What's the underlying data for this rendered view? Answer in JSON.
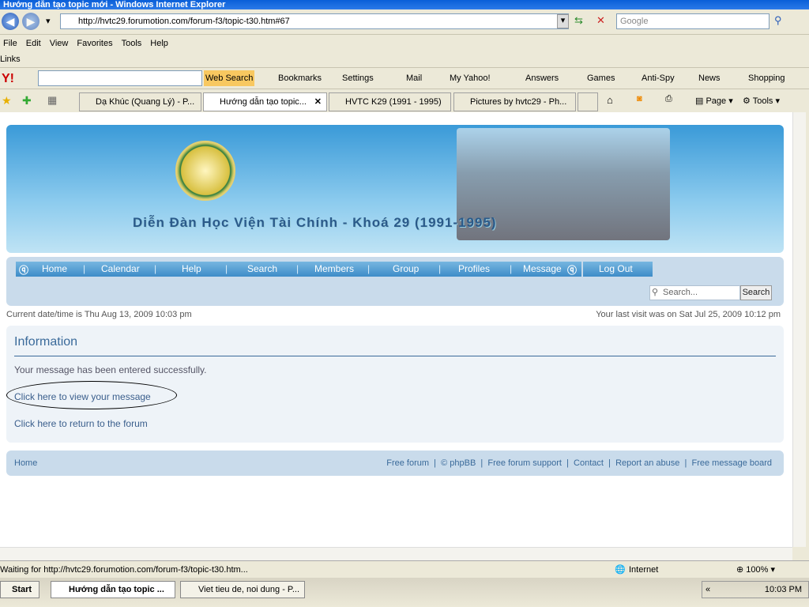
{
  "window": {
    "title": "Hướng dẫn tạo topic mới - Windows Internet Explorer"
  },
  "address": {
    "url": "http://hvtc29.forumotion.com/forum-f3/topic-t30.htm#67",
    "search_placeholder": "Google"
  },
  "menu": [
    "File",
    "Edit",
    "View",
    "Favorites",
    "Tools",
    "Help"
  ],
  "links_label": "Links",
  "yahoo_toolbar": {
    "web_search": "Web Search",
    "items": [
      "Bookmarks",
      "Settings",
      "Mail",
      "My Yahoo!",
      "Answers",
      "Games",
      "Anti-Spy",
      "News",
      "Shopping"
    ]
  },
  "tabs": [
    "Dạ Khúc (Quang Lý) - P...",
    "Hướng dẫn tạo topic...",
    "HVTC K29 (1991 - 1995)",
    "Pictures by hvtc29 - Ph..."
  ],
  "command_bar": {
    "page": "Page",
    "tools": "Tools"
  },
  "banner": {
    "title": "Diễn Đàn Học Viện Tài Chính - Khoá 29 (1991-1995)"
  },
  "nav": [
    "Home",
    "Calendar",
    "Help",
    "Search",
    "Members",
    "Group",
    "Profiles",
    "Message",
    "Log Out"
  ],
  "search": {
    "placeholder": "Search...",
    "button": "Search"
  },
  "current_time": "Current date/time is Thu Aug 13, 2009 10:03 pm",
  "last_visit": "Your last visit was on Sat Jul 25, 2009 10:12 pm",
  "info": {
    "heading": "Information",
    "message": "Your message has been entered successfully.",
    "view_link": "Click here to view your message",
    "return_link": "Click here to return to the forum"
  },
  "footer": {
    "home": "Home",
    "links": [
      "Free forum",
      "©  phpBB",
      "Free forum support",
      "Contact",
      "Report an abuse",
      "Free message board"
    ]
  },
  "status": {
    "text": "Waiting for http://hvtc29.forumotion.com/forum-f3/topic-t30.htm...",
    "zone": "Internet",
    "zoom": "100%"
  },
  "taskbar": {
    "start": "Start",
    "tasks": [
      "Hướng dẫn tạo topic ...",
      "Viet tieu de, noi dung - P..."
    ],
    "clock": "10:03 PM"
  }
}
